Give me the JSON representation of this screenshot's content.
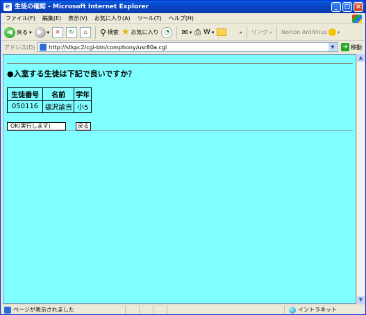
{
  "window": {
    "title": "生徒の確認 - Microsoft Internet Explorer"
  },
  "menu": {
    "items": [
      "ファイル(F)",
      "編集(E)",
      "表示(V)",
      "お気に入り(A)",
      "ツール(T)",
      "ヘルプ(H)"
    ]
  },
  "toolbar": {
    "back": "戻る",
    "search": "検索",
    "favorites": "お気に入り",
    "links": "リンク",
    "norton": "Norton AntiVirus"
  },
  "address": {
    "label": "アドレス(D)",
    "url": "http://stkpc2/cgi-bin/comphony/usr80a.cgi",
    "go": "移動"
  },
  "page": {
    "question": "●入室する生徒は下記で良いですか？",
    "table": {
      "headers": [
        "生徒番号",
        "名前",
        "学年"
      ],
      "rows": [
        [
          "050116",
          "福沢諭吉",
          "小5"
        ]
      ]
    },
    "ok_button": "OK(実行します)",
    "back_button": "戻る"
  },
  "status": {
    "text": "ページが表示されました",
    "zone": "イントラネット"
  },
  "colors": {
    "content_bg": "#7fffff",
    "titlebar": "#0a46c8"
  }
}
